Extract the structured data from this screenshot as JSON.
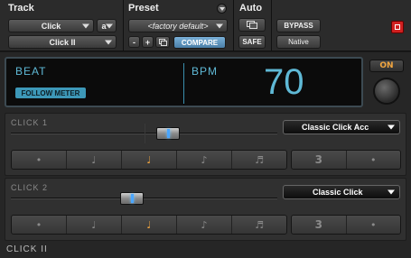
{
  "header": {
    "track_label": "Track",
    "preset_label": "Preset",
    "auto_label": "Auto",
    "track_name": "Click",
    "track_group": "a",
    "insert_name": "Click II",
    "preset_name": "<factory default>",
    "minus": "-",
    "plus": "+",
    "compare": "COMPARE",
    "safe": "SAFE",
    "bypass": "BYPASS",
    "native": "Native"
  },
  "display": {
    "beat_label": "BEAT",
    "bpm_label": "BPM",
    "bpm_value": "70",
    "follow_meter": "FOLLOW METER",
    "on_label": "ON"
  },
  "click1": {
    "label": "CLICK 1",
    "sound": "Classic Click Acc",
    "level": 0.6,
    "segments": [
      "•",
      "♩",
      "♩",
      "♪",
      "♬"
    ],
    "active_segment": 2,
    "right_segments": [
      "3",
      "•"
    ]
  },
  "click2": {
    "label": "CLICK 2",
    "sound": "Classic Click",
    "level": 0.45,
    "segments": [
      "•",
      "♩",
      "♩",
      "♪",
      "♬"
    ],
    "active_segment": 2,
    "right_segments": [
      "3",
      "•"
    ]
  },
  "footer": {
    "label": "CLICK II"
  },
  "colors": {
    "accent_blue": "#5fb9d6",
    "accent_orange": "#f2a640",
    "close_red": "#d02020"
  }
}
